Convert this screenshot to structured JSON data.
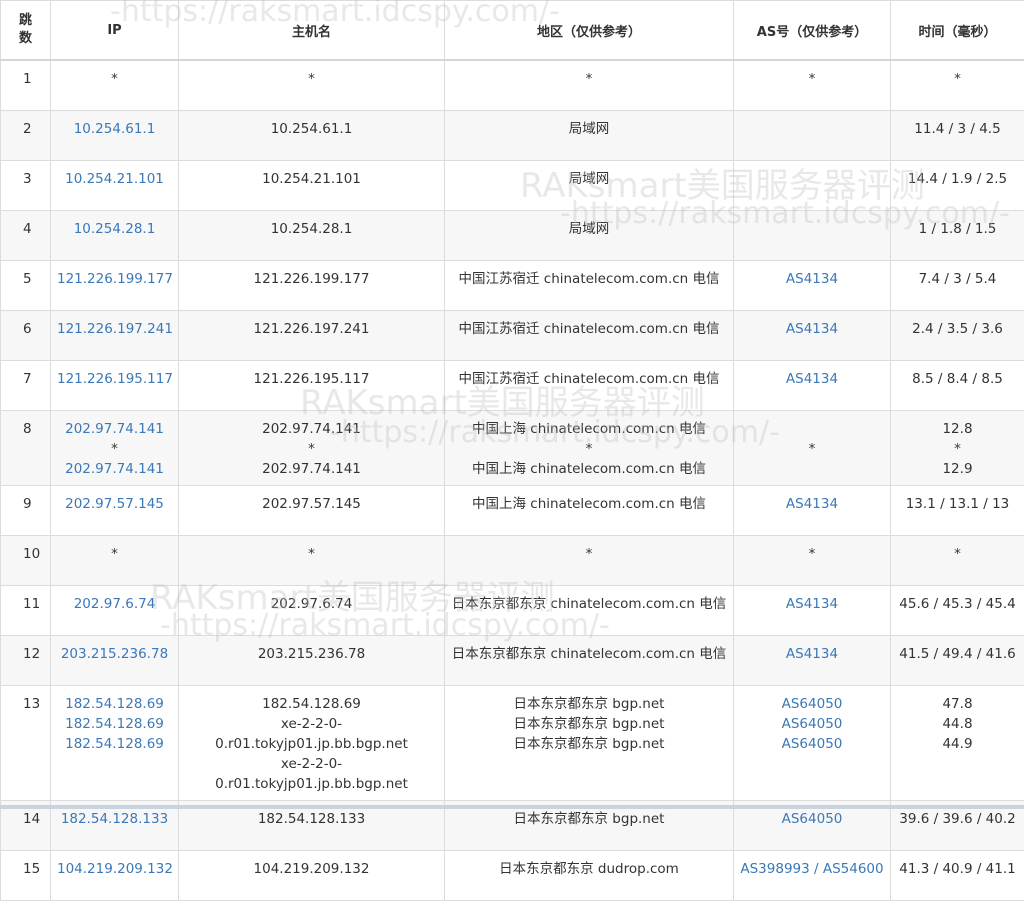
{
  "headers": {
    "hop": "跳数",
    "ip": "IP",
    "host": "主机名",
    "region": "地区（仅供参考）",
    "as": "AS号（仅供参考）",
    "time": "时间（毫秒）"
  },
  "watermark": {
    "text": "RAKsmart美国服务器评测",
    "url": "-https://raksmart.idcspy.com/-"
  },
  "rows": [
    {
      "hop": "1",
      "ip": [
        "*"
      ],
      "host": [
        "*"
      ],
      "region": [
        "*"
      ],
      "as": [
        "*"
      ],
      "time": [
        "*"
      ]
    },
    {
      "hop": "2",
      "ip": [
        "10.254.61.1"
      ],
      "host": [
        "10.254.61.1"
      ],
      "region": [
        "局域网"
      ],
      "as": [
        ""
      ],
      "time": [
        "11.4 / 3 / 4.5"
      ]
    },
    {
      "hop": "3",
      "ip": [
        "10.254.21.101"
      ],
      "host": [
        "10.254.21.101"
      ],
      "region": [
        "局域网"
      ],
      "as": [
        ""
      ],
      "time": [
        "14.4 / 1.9 / 2.5"
      ]
    },
    {
      "hop": "4",
      "ip": [
        "10.254.28.1"
      ],
      "host": [
        "10.254.28.1"
      ],
      "region": [
        "局域网"
      ],
      "as": [
        ""
      ],
      "time": [
        "1 / 1.8 / 1.5"
      ]
    },
    {
      "hop": "5",
      "ip": [
        "121.226.199.177"
      ],
      "host": [
        "121.226.199.177"
      ],
      "region": [
        "中国江苏宿迁 chinatelecom.com.cn 电信"
      ],
      "as": [
        "AS4134"
      ],
      "time": [
        "7.4 / 3 / 5.4"
      ]
    },
    {
      "hop": "6",
      "ip": [
        "121.226.197.241"
      ],
      "host": [
        "121.226.197.241"
      ],
      "region": [
        "中国江苏宿迁 chinatelecom.com.cn 电信"
      ],
      "as": [
        "AS4134"
      ],
      "time": [
        "2.4 / 3.5 / 3.6"
      ]
    },
    {
      "hop": "7",
      "ip": [
        "121.226.195.117"
      ],
      "host": [
        "121.226.195.117"
      ],
      "region": [
        "中国江苏宿迁 chinatelecom.com.cn 电信"
      ],
      "as": [
        "AS4134"
      ],
      "time": [
        "8.5 / 8.4 / 8.5"
      ]
    },
    {
      "hop": "8",
      "ip": [
        "202.97.74.141",
        "*",
        "202.97.74.141"
      ],
      "host": [
        "202.97.74.141",
        "*",
        "202.97.74.141"
      ],
      "region": [
        "中国上海 chinatelecom.com.cn 电信",
        "*",
        "中国上海 chinatelecom.com.cn 电信"
      ],
      "as": [
        "*"
      ],
      "time": [
        "12.8",
        "*",
        "12.9"
      ]
    },
    {
      "hop": "9",
      "ip": [
        "202.97.57.145"
      ],
      "host": [
        "202.97.57.145"
      ],
      "region": [
        "中国上海 chinatelecom.com.cn 电信"
      ],
      "as": [
        "AS4134"
      ],
      "time": [
        "13.1 / 13.1 / 13"
      ]
    },
    {
      "hop": "10",
      "ip": [
        "*"
      ],
      "host": [
        "*"
      ],
      "region": [
        "*"
      ],
      "as": [
        "*"
      ],
      "time": [
        "*"
      ]
    },
    {
      "hop": "11",
      "ip": [
        "202.97.6.74"
      ],
      "host": [
        "202.97.6.74"
      ],
      "region": [
        "日本东京都东京 chinatelecom.com.cn 电信"
      ],
      "as": [
        "AS4134"
      ],
      "time": [
        "45.6 / 45.3 / 45.4"
      ]
    },
    {
      "hop": "12",
      "ip": [
        "203.215.236.78"
      ],
      "host": [
        "203.215.236.78"
      ],
      "region": [
        "日本东京都东京 chinatelecom.com.cn 电信"
      ],
      "as": [
        "AS4134"
      ],
      "time": [
        "41.5 / 49.4 / 41.6"
      ]
    },
    {
      "hop": "13",
      "ip": [
        "182.54.128.69",
        "182.54.128.69",
        "182.54.128.69"
      ],
      "host": [
        "182.54.128.69",
        "xe-2-2-0-0.r01.tokyjp01.jp.bb.bgp.net",
        "xe-2-2-0-0.r01.tokyjp01.jp.bb.bgp.net"
      ],
      "region": [
        "日本东京都东京 bgp.net",
        "日本东京都东京 bgp.net",
        "日本东京都东京 bgp.net"
      ],
      "as": [
        "AS64050",
        "AS64050",
        "AS64050"
      ],
      "time": [
        "47.8",
        "44.8",
        "44.9"
      ]
    },
    {
      "hop": "14",
      "ip": [
        "182.54.128.133"
      ],
      "host": [
        "182.54.128.133"
      ],
      "region": [
        "日本东京都东京 bgp.net"
      ],
      "as": [
        "AS64050"
      ],
      "time": [
        "39.6 / 39.6 / 40.2"
      ]
    },
    {
      "hop": "15",
      "ip": [
        "104.219.209.132"
      ],
      "host": [
        "104.219.209.132"
      ],
      "region": [
        "日本东京都东京 dudrop.com"
      ],
      "as": [
        "AS398993 / AS54600"
      ],
      "time": [
        "41.3 / 40.9 / 41.1"
      ]
    }
  ]
}
